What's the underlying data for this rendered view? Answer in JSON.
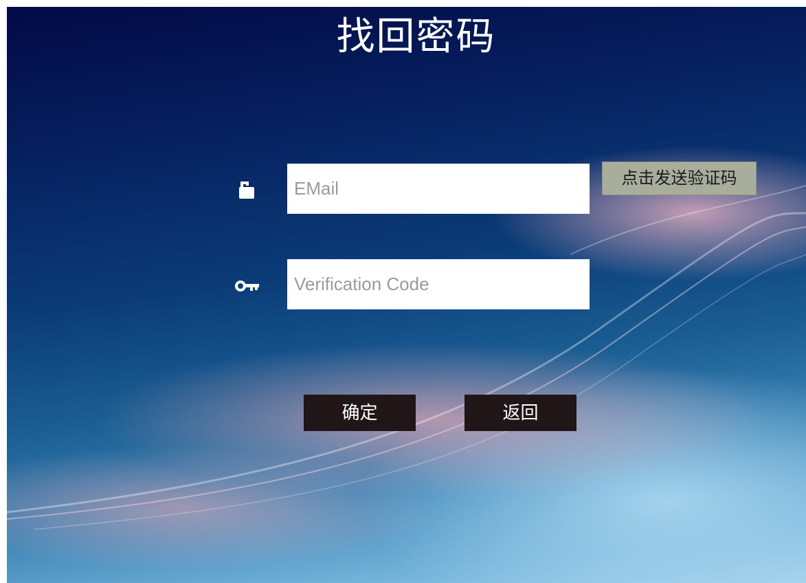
{
  "page": {
    "title": "找回密码"
  },
  "form": {
    "email": {
      "icon": "unlock-icon",
      "placeholder": "EMail",
      "value": ""
    },
    "code": {
      "icon": "key-icon",
      "placeholder": "Verification Code",
      "value": ""
    },
    "send_code_label": "点击发送验证码"
  },
  "actions": {
    "confirm_label": "确定",
    "back_label": "返回"
  },
  "colors": {
    "send_button_bg": "#a8ad9c",
    "action_button_bg": "#201617",
    "field_bg": "#ffffff"
  }
}
